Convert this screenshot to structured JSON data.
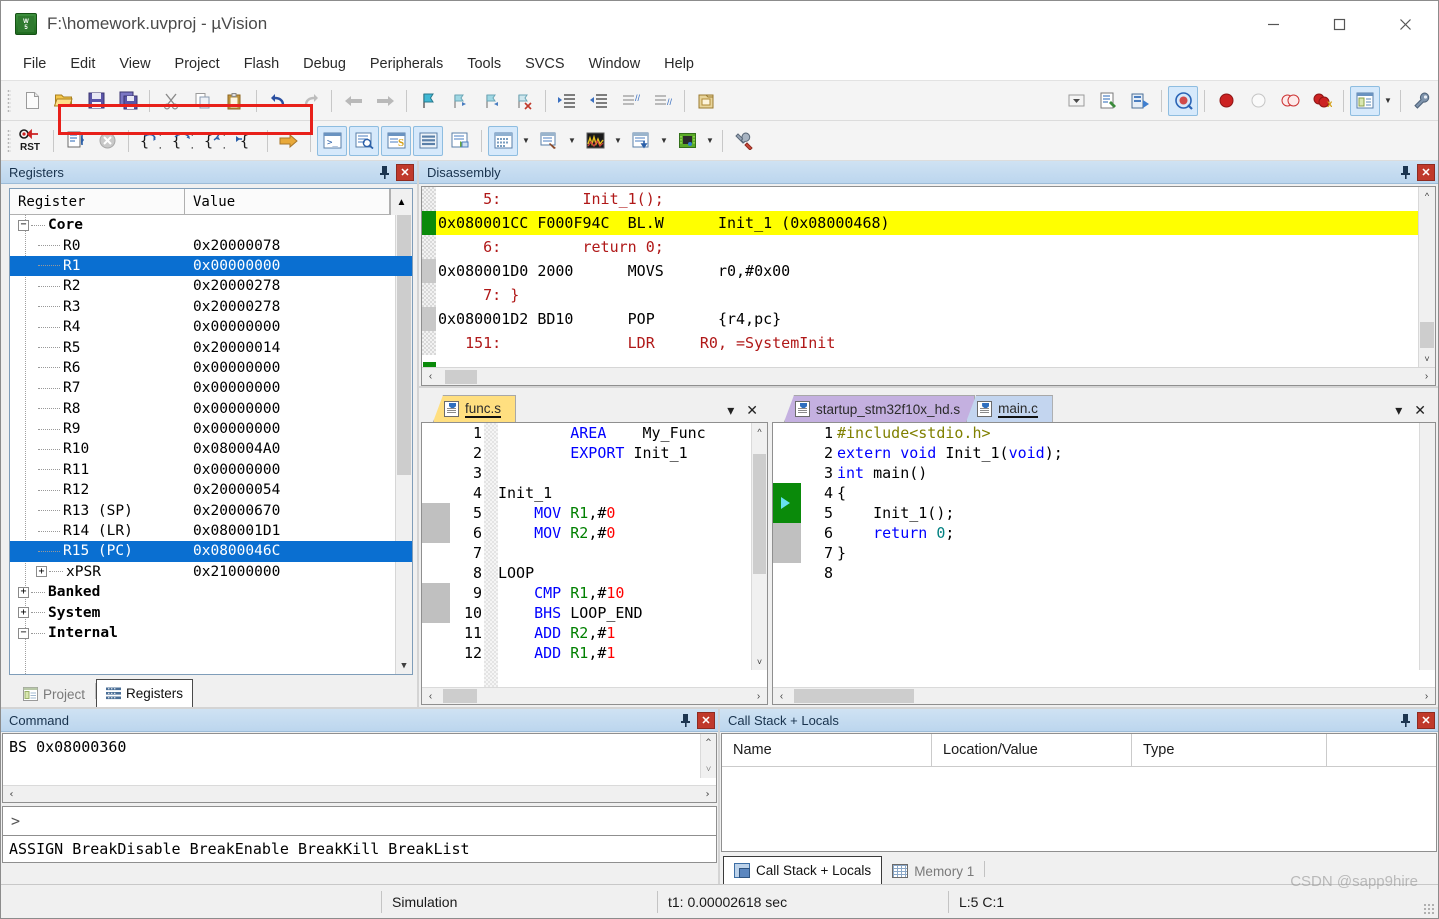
{
  "window": {
    "title": "F:\\homework.uvproj - µVision",
    "app_icon": "uvision-logo-icon",
    "minimize": "—",
    "maximize": "▢",
    "close": "✕"
  },
  "menubar": {
    "items": [
      {
        "label": "File"
      },
      {
        "label": "Edit"
      },
      {
        "label": "View"
      },
      {
        "label": "Project"
      },
      {
        "label": "Flash"
      },
      {
        "label": "Debug"
      },
      {
        "label": "Peripherals"
      },
      {
        "label": "Tools"
      },
      {
        "label": "SVCS"
      },
      {
        "label": "Window"
      },
      {
        "label": "Help"
      }
    ]
  },
  "toolbar_main": {
    "buttons": [
      {
        "name": "new-file-icon",
        "title": "New"
      },
      {
        "name": "open-file-icon",
        "title": "Open"
      },
      {
        "name": "save-icon",
        "title": "Save"
      },
      {
        "name": "save-all-icon",
        "title": "Save All"
      },
      {
        "name": "cut-icon",
        "title": "Cut"
      },
      {
        "name": "copy-icon",
        "title": "Copy"
      },
      {
        "name": "paste-icon",
        "title": "Paste"
      },
      {
        "name": "undo-icon",
        "title": "Undo"
      },
      {
        "name": "redo-icon",
        "title": "Redo"
      },
      {
        "name": "navigate-back-icon",
        "title": "Back"
      },
      {
        "name": "navigate-forward-icon",
        "title": "Forward"
      },
      {
        "name": "bookmark-toggle-icon",
        "title": "Insert/Remove Bookmark"
      },
      {
        "name": "bookmark-prev-icon",
        "title": "Previous Bookmark"
      },
      {
        "name": "bookmark-next-icon",
        "title": "Next Bookmark"
      },
      {
        "name": "bookmark-clear-icon",
        "title": "Clear Bookmarks"
      },
      {
        "name": "indent-icon",
        "title": "Indent"
      },
      {
        "name": "outdent-icon",
        "title": "Outdent"
      },
      {
        "name": "comment-icon",
        "title": "Comment"
      },
      {
        "name": "uncomment-icon",
        "title": "Uncomment"
      },
      {
        "name": "build-icon",
        "title": "Build"
      },
      {
        "name": "dropdown-target-icon",
        "title": "Select Target"
      },
      {
        "name": "target-options-icon",
        "title": "Options for Target"
      },
      {
        "name": "manage-components-icon",
        "title": "Manage Components"
      },
      {
        "name": "start-debug-icon",
        "title": "Start/Stop Debug Session"
      },
      {
        "name": "insert-breakpoint-icon",
        "title": "Insert/Remove Breakpoint"
      },
      {
        "name": "disable-breakpoint-icon",
        "title": "Enable/Disable Breakpoint"
      },
      {
        "name": "disable-all-breakpoints-icon",
        "title": "Disable All Breakpoints"
      },
      {
        "name": "kill-all-breakpoints-icon",
        "title": "Kill All Breakpoints"
      },
      {
        "name": "project-window-icon",
        "title": "Project Window"
      },
      {
        "name": "configuration-wizard-icon",
        "title": "Configuration Wizard"
      }
    ]
  },
  "toolbar_debug": {
    "buttons": [
      {
        "name": "reset-cpu-icon",
        "title": "Reset CPU",
        "label": "RST"
      },
      {
        "name": "run-icon",
        "title": "Run"
      },
      {
        "name": "stop-icon",
        "title": "Stop"
      },
      {
        "name": "step-into-icon",
        "title": "Step"
      },
      {
        "name": "step-over-icon",
        "title": "Step Over"
      },
      {
        "name": "step-out-icon",
        "title": "Step Out"
      },
      {
        "name": "run-to-cursor-icon",
        "title": "Run to Cursor Line"
      },
      {
        "name": "show-next-statement-icon",
        "title": "Show Next Statement"
      },
      {
        "name": "command-window-icon",
        "title": "Command Window"
      },
      {
        "name": "disassembly-window-icon",
        "title": "Disassembly Window"
      },
      {
        "name": "symbols-window-icon",
        "title": "Symbols Window"
      },
      {
        "name": "registers-window-icon",
        "title": "Registers Window"
      },
      {
        "name": "call-stack-window-icon",
        "title": "Call Stack Window"
      },
      {
        "name": "watch-windows-icon",
        "title": "Watch Windows"
      },
      {
        "name": "memory-windows-icon",
        "title": "Memory Windows"
      },
      {
        "name": "serial-windows-icon",
        "title": "Serial Windows"
      },
      {
        "name": "analysis-windows-icon",
        "title": "Analysis Windows"
      },
      {
        "name": "trace-windows-icon",
        "title": "Trace Windows"
      },
      {
        "name": "system-viewer-icon",
        "title": "System Viewer"
      },
      {
        "name": "toolbox-icon",
        "title": "Debug Toolbox"
      }
    ]
  },
  "registers_panel": {
    "title": "Registers",
    "pin": "pin-icon",
    "close": "✕",
    "columns": [
      "Register",
      "Value"
    ],
    "tree": [
      {
        "name": "Core",
        "value": "",
        "level": 0,
        "expander": "−",
        "selected": false,
        "bold": true
      },
      {
        "name": "R0",
        "value": "0x20000078",
        "level": 1,
        "expander": "",
        "selected": false
      },
      {
        "name": "R1",
        "value": "0x00000000",
        "level": 1,
        "expander": "",
        "selected": true
      },
      {
        "name": "R2",
        "value": "0x20000278",
        "level": 1,
        "expander": "",
        "selected": false
      },
      {
        "name": "R3",
        "value": "0x20000278",
        "level": 1,
        "expander": "",
        "selected": false
      },
      {
        "name": "R4",
        "value": "0x00000000",
        "level": 1,
        "expander": "",
        "selected": false
      },
      {
        "name": "R5",
        "value": "0x20000014",
        "level": 1,
        "expander": "",
        "selected": false
      },
      {
        "name": "R6",
        "value": "0x00000000",
        "level": 1,
        "expander": "",
        "selected": false
      },
      {
        "name": "R7",
        "value": "0x00000000",
        "level": 1,
        "expander": "",
        "selected": false
      },
      {
        "name": "R8",
        "value": "0x00000000",
        "level": 1,
        "expander": "",
        "selected": false
      },
      {
        "name": "R9",
        "value": "0x00000000",
        "level": 1,
        "expander": "",
        "selected": false
      },
      {
        "name": "R10",
        "value": "0x080004A0",
        "level": 1,
        "expander": "",
        "selected": false
      },
      {
        "name": "R11",
        "value": "0x00000000",
        "level": 1,
        "expander": "",
        "selected": false
      },
      {
        "name": "R12",
        "value": "0x20000054",
        "level": 1,
        "expander": "",
        "selected": false
      },
      {
        "name": "R13 (SP)",
        "value": "0x20000670",
        "level": 1,
        "expander": "",
        "selected": false
      },
      {
        "name": "R14 (LR)",
        "value": "0x080001D1",
        "level": 1,
        "expander": "",
        "selected": false
      },
      {
        "name": "R15 (PC)",
        "value": "0x0800046C",
        "level": 1,
        "expander": "",
        "selected": true
      },
      {
        "name": "xPSR",
        "value": "0x21000000",
        "level": 1,
        "expander": "+",
        "selected": false
      },
      {
        "name": "Banked",
        "value": "",
        "level": 0,
        "expander": "+",
        "selected": false,
        "bold": true
      },
      {
        "name": "System",
        "value": "",
        "level": 0,
        "expander": "+",
        "selected": false,
        "bold": true
      },
      {
        "name": "Internal",
        "value": "",
        "level": 0,
        "expander": "−",
        "selected": false,
        "bold": true
      }
    ],
    "tabs": [
      {
        "label": "Project",
        "icon": "project-window-icon",
        "active": false
      },
      {
        "label": "Registers",
        "icon": "registers-window-icon",
        "active": true
      }
    ]
  },
  "disassembly_panel": {
    "title": "Disassembly",
    "pin": "pin-icon",
    "close": "✕",
    "lines": [
      {
        "kind": "source",
        "text": "     5:         Init_1();",
        "current": false,
        "marker": "checker"
      },
      {
        "kind": "asm",
        "text": "0x080001CC F000F94C  BL.W      Init_1 (0x08000468)",
        "current": true,
        "marker": "pc"
      },
      {
        "kind": "source",
        "text": "     6:         return 0;",
        "current": false,
        "marker": "checker"
      },
      {
        "kind": "asm",
        "text": "0x080001D0 2000      MOVS      r0,#0x00",
        "current": false,
        "marker": "gray"
      },
      {
        "kind": "source",
        "text": "     7: }",
        "current": false,
        "marker": "checker"
      },
      {
        "kind": "asm",
        "text": "0x080001D2 BD10      POP       {r4,pc}",
        "current": false,
        "marker": "gray"
      },
      {
        "kind": "source",
        "text": "   151:              LDR     R0, =SystemInit",
        "current": false,
        "marker": "checker"
      }
    ]
  },
  "editor_left": {
    "tabs": [
      {
        "label": "func.s",
        "icon": "asm-file-icon",
        "active": true,
        "color": "yellow"
      }
    ],
    "dropdown": "▾",
    "close": "✕",
    "lines": [
      {
        "n": "1",
        "tokens": [
          {
            "t": "        ",
            "c": "plain"
          },
          {
            "t": "AREA",
            "c": "kw"
          },
          {
            "t": "    My_Func",
            "c": "plain"
          }
        ]
      },
      {
        "n": "2",
        "tokens": [
          {
            "t": "        ",
            "c": "plain"
          },
          {
            "t": "EXPORT",
            "c": "kw"
          },
          {
            "t": " Init_1",
            "c": "plain"
          }
        ]
      },
      {
        "n": "3",
        "tokens": [
          {
            "t": "",
            "c": "plain"
          }
        ]
      },
      {
        "n": "4",
        "tokens": [
          {
            "t": "Init_1",
            "c": "plain"
          }
        ]
      },
      {
        "n": "5",
        "tokens": [
          {
            "t": "    ",
            "c": "plain"
          },
          {
            "t": "MOV",
            "c": "kw"
          },
          {
            "t": " ",
            "c": "plain"
          },
          {
            "t": "R1",
            "c": "reg"
          },
          {
            "t": ",#",
            "c": "plain"
          },
          {
            "t": "0",
            "c": "num"
          }
        ]
      },
      {
        "n": "6",
        "tokens": [
          {
            "t": "    ",
            "c": "plain"
          },
          {
            "t": "MOV",
            "c": "kw"
          },
          {
            "t": " ",
            "c": "plain"
          },
          {
            "t": "R2",
            "c": "reg"
          },
          {
            "t": ",#",
            "c": "plain"
          },
          {
            "t": "0",
            "c": "num"
          }
        ]
      },
      {
        "n": "7",
        "tokens": [
          {
            "t": "",
            "c": "plain"
          }
        ]
      },
      {
        "n": "8",
        "tokens": [
          {
            "t": "LOOP",
            "c": "plain"
          }
        ]
      },
      {
        "n": "9",
        "tokens": [
          {
            "t": "    ",
            "c": "plain"
          },
          {
            "t": "CMP",
            "c": "kw"
          },
          {
            "t": " ",
            "c": "plain"
          },
          {
            "t": "R1",
            "c": "reg"
          },
          {
            "t": ",#",
            "c": "plain"
          },
          {
            "t": "10",
            "c": "num"
          }
        ]
      },
      {
        "n": "10",
        "tokens": [
          {
            "t": "    ",
            "c": "plain"
          },
          {
            "t": "BHS",
            "c": "kw"
          },
          {
            "t": " LOOP_END",
            "c": "plain"
          }
        ]
      },
      {
        "n": "11",
        "tokens": [
          {
            "t": "    ",
            "c": "plain"
          },
          {
            "t": "ADD",
            "c": "kw"
          },
          {
            "t": " ",
            "c": "plain"
          },
          {
            "t": "R2",
            "c": "reg"
          },
          {
            "t": ",#",
            "c": "plain"
          },
          {
            "t": "1",
            "c": "num"
          }
        ]
      },
      {
        "n": "12",
        "tokens": [
          {
            "t": "    ",
            "c": "plain"
          },
          {
            "t": "ADD",
            "c": "kw"
          },
          {
            "t": " ",
            "c": "plain"
          },
          {
            "t": "R1",
            "c": "reg"
          },
          {
            "t": ",#",
            "c": "plain"
          },
          {
            "t": "1",
            "c": "num"
          }
        ]
      }
    ]
  },
  "editor_right": {
    "tabs": [
      {
        "label": "startup_stm32f10x_hd.s",
        "icon": "asm-file-icon",
        "active": false,
        "color": "purple"
      },
      {
        "label": "main.c",
        "icon": "c-file-icon",
        "active": true,
        "color": "blue"
      }
    ],
    "dropdown": "▾",
    "close": "✕",
    "lines": [
      {
        "n": "1",
        "tokens": [
          {
            "t": "#include<stdio.h>",
            "c": "inc"
          }
        ]
      },
      {
        "n": "2",
        "tokens": [
          {
            "t": "extern void",
            "c": "kw"
          },
          {
            "t": " Init_1(",
            "c": "plain"
          },
          {
            "t": "void",
            "c": "kw"
          },
          {
            "t": ");",
            "c": "plain"
          }
        ]
      },
      {
        "n": "3",
        "tokens": [
          {
            "t": "int",
            "c": "kw"
          },
          {
            "t": " main()",
            "c": "plain"
          }
        ]
      },
      {
        "n": "4",
        "tokens": [
          {
            "t": "{",
            "c": "plain"
          }
        ]
      },
      {
        "n": "5",
        "tokens": [
          {
            "t": "    Init_1();",
            "c": "plain"
          }
        ]
      },
      {
        "n": "6",
        "tokens": [
          {
            "t": "    ",
            "c": "plain"
          },
          {
            "t": "return",
            "c": "kw"
          },
          {
            "t": " ",
            "c": "plain"
          },
          {
            "t": "0",
            "c": "cyan"
          },
          {
            "t": ";",
            "c": "plain"
          }
        ]
      },
      {
        "n": "7",
        "tokens": [
          {
            "t": "}",
            "c": "plain"
          }
        ]
      },
      {
        "n": "8",
        "tokens": [
          {
            "t": "",
            "c": "plain"
          }
        ]
      }
    ],
    "current_line": 5
  },
  "command_panel": {
    "title": "Command",
    "pin": "pin-icon",
    "close": "✕",
    "output": "BS  0x08000360",
    "prompt": ">",
    "input_value": "",
    "hints": "ASSIGN BreakDisable BreakEnable BreakKill BreakList"
  },
  "call_stack_panel": {
    "title": "Call Stack + Locals",
    "pin": "pin-icon",
    "close": "✕",
    "columns": [
      "Name",
      "Location/Value",
      "Type",
      ""
    ],
    "rows": [],
    "tabs": [
      {
        "label": "Call Stack + Locals",
        "icon": "call-stack-icon",
        "active": true
      },
      {
        "label": "Memory 1",
        "icon": "memory-icon",
        "active": false
      }
    ]
  },
  "statusbar": {
    "mode": "Simulation",
    "time": "t1: 0.00002618 sec",
    "cursor": "L:5 C:1"
  },
  "watermark": "CSDN @sapp9hire",
  "colors": {
    "accent_blue": "#0a6fd1",
    "highlight_yellow": "#ffff00",
    "pc_green": "#0a8a0a",
    "annotation_red": "#e8201a",
    "panel_header": "#cfe2f3",
    "keyword_blue": "#0000ff",
    "register_green": "#008000",
    "number_red": "#ff0000",
    "source_red": "#b01818"
  }
}
